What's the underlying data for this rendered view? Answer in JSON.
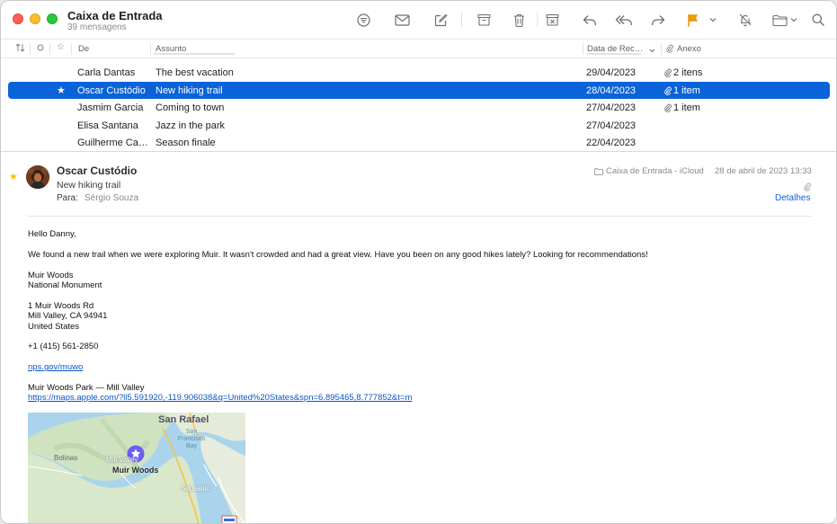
{
  "mailbox": {
    "title": "Caixa de Entrada",
    "count": "39 mensagens"
  },
  "columns": {
    "sort_icon": "sort-icon",
    "unread": "unread-column-icon",
    "flag": "star-column-icon",
    "from": "De",
    "subject": "Assunto",
    "date": "Data de Rec…",
    "attachment": "Anexo"
  },
  "messages": [
    {
      "from": "Carla Dantas",
      "subject": "The best vacation",
      "date": "29/04/2023",
      "attachment": "2 itens",
      "starred": false,
      "selected": false
    },
    {
      "from": "Oscar Custódio",
      "subject": "New hiking trail",
      "date": "28/04/2023",
      "attachment": "1 item",
      "starred": true,
      "selected": true
    },
    {
      "from": "Jasmim Garcia",
      "subject": "Coming to town",
      "date": "27/04/2023",
      "attachment": "1 item",
      "starred": false,
      "selected": false
    },
    {
      "from": "Elisa Santana",
      "subject": "Jazz in the park",
      "date": "27/04/2023",
      "attachment": "",
      "starred": false,
      "selected": false
    },
    {
      "from": "Guilherme Ca…",
      "subject": "Season finale",
      "date": "22/04/2023",
      "attachment": "",
      "starred": false,
      "selected": false
    }
  ],
  "message": {
    "sender": "Oscar Custódio",
    "subject": "New hiking trail",
    "to_label": "Para:",
    "to": "Sérgio Souza",
    "mailbox": "Caixa de Entrada - iCloud",
    "date": "28 de abril de 2023 13:33",
    "details": "Detalhes",
    "body": {
      "greeting": "Hello Danny,",
      "paragraph": "We found a new trail when we were exploring Muir. It wasn't crowded and had a great view. Have you been on any good hikes lately? Looking for recommendations!",
      "place_name": "Muir Woods",
      "place_type": "National Monument",
      "address1": "1 Muir Woods Rd",
      "address2": "Mill Valley, CA 94941",
      "address3": "United States",
      "phone": "+1 (415) 561-2850",
      "site": "nps.gov/muwo",
      "map_title": "Muir Woods Park — Mill Valley",
      "map_url": "https://maps.apple.com/?ll5.591920,-119.906038&q=United%20States&spn=6.895465,8.777852&t=m"
    },
    "map": {
      "labels": {
        "san_rafael": "San Rafael",
        "san_francisco_bay": "San Francisco Bay",
        "mill_valley": "Mill Valley",
        "bolinas": "Bolinas",
        "muir_woods": "Muir Woods",
        "sausalito": "Sausalito"
      }
    }
  },
  "colors": {
    "accent": "#0a63d8",
    "flag": "#f29a00",
    "star": "#f5c000"
  }
}
